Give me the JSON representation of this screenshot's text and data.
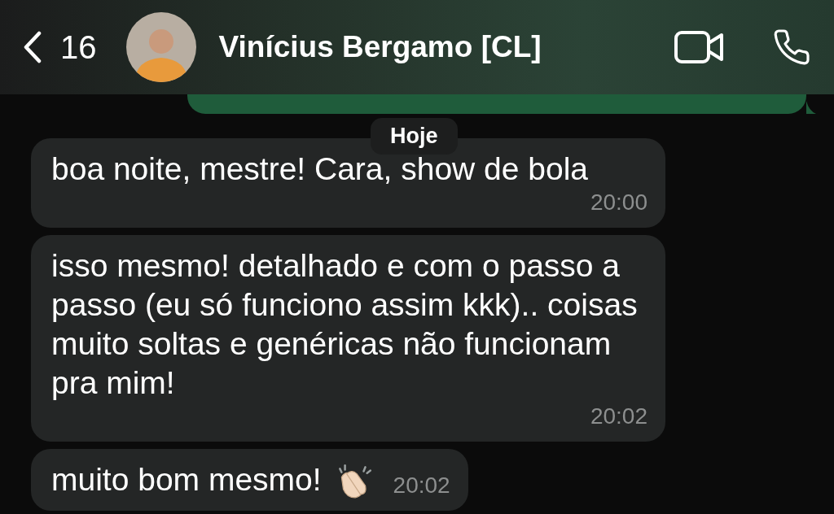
{
  "header": {
    "back_count": "16",
    "contact_name": "Vinícius Bergamo [CL]"
  },
  "date_divider": "Hoje",
  "messages": [
    {
      "kind": "text",
      "text": "boa noite, mestre! Cara, show de bola",
      "time": "20:00"
    },
    {
      "kind": "text",
      "text": "isso mesmo! detalhado e com o passo a passo (eu só funciono assim kkk).. coisas muito soltas e genéricas não funcionam pra mim!",
      "time": "20:02"
    },
    {
      "kind": "clap",
      "text": "muito bom mesmo!",
      "time": "20:02"
    }
  ]
}
